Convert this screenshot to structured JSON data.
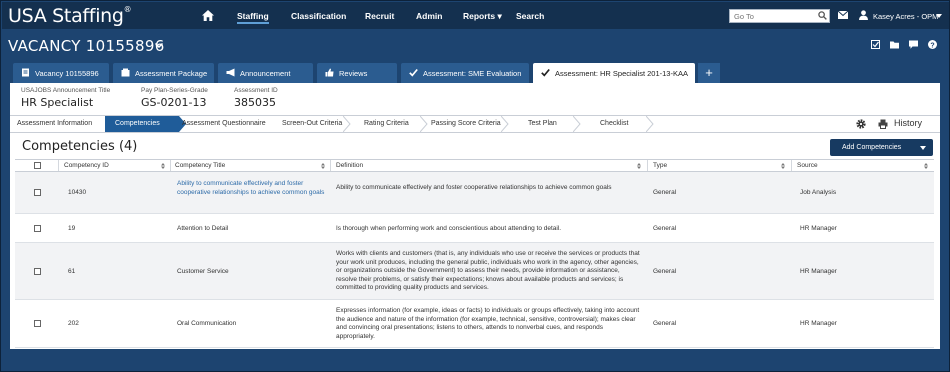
{
  "app": {
    "logo": "USA Staffing",
    "logo_mark": "®"
  },
  "topnav": {
    "items": [
      "Staffing",
      "Classification",
      "Recruit",
      "Admin",
      "Reports",
      "Search"
    ],
    "reports_caret": "▾",
    "goto_placeholder": "Go To",
    "user": "Kasey Acres - OPM"
  },
  "vacancy": {
    "title": "VACANCY 10155896"
  },
  "tabs": [
    {
      "label": "Vacancy 10155896",
      "icon": "document-icon"
    },
    {
      "label": "Assessment Package",
      "icon": "package-icon"
    },
    {
      "label": "Announcement",
      "icon": "megaphone-icon"
    },
    {
      "label": "Reviews",
      "icon": "thumbs-up-icon"
    },
    {
      "label": "Assessment: SME Evaluation",
      "icon": "check-icon"
    },
    {
      "label": "Assessment: HR Specialist 201-13-KAA",
      "icon": "check-icon"
    }
  ],
  "add_tab_label": "+",
  "meta": {
    "announcement_label": "USAJOBS Announcement Title",
    "announcement_value": "HR Specialist",
    "ppsg_label": "Pay Plan-Series-Grade",
    "ppsg_value": "GS-0201-13",
    "assessment_label": "Assessment ID",
    "assessment_value": "385035"
  },
  "steps": [
    "Assessment Information",
    "Competencies",
    "Assessment Questionnaire",
    "Screen-Out Criteria",
    "Rating Criteria",
    "Passing Score Criteria",
    "Test Plan",
    "Checklist"
  ],
  "active_step": "Competencies",
  "history_label": "History",
  "section": {
    "title": "Competencies (4)",
    "add_button": "Add Competencies"
  },
  "table": {
    "headers": [
      "Competency ID",
      "Competency Title",
      "Definition",
      "Type",
      "Source"
    ],
    "rows": [
      {
        "id": "10430",
        "title": "Ability to communicate effectively and foster cooperative relationships to achieve common goals",
        "definition": "Ability to communicate effectively and foster cooperative relationships to achieve common goals",
        "type": "General",
        "source": "Job Analysis"
      },
      {
        "id": "19",
        "title": "Attention to Detail",
        "definition": "Is thorough when performing work and conscientious about attending to detail.",
        "type": "General",
        "source": "HR Manager"
      },
      {
        "id": "61",
        "title": "Customer Service",
        "definition": "Works with clients and customers (that is, any individuals who use or receive the services or products that your work unit produces, including the general public, individuals who work in the agency, other agencies, or organizations outside the Government) to assess their needs, provide information or assistance, resolve their problems, or satisfy their expectations; knows about available products and services; is committed to providing quality products and services.",
        "type": "General",
        "source": "HR Manager"
      },
      {
        "id": "202",
        "title": "Oral Communication",
        "definition": "Expresses information (for example, ideas or facts) to individuals or groups effectively, taking into account the audience and nature of the information (for example, technical, sensitive, controversial); makes clear and convincing oral presentations; listens to others, attends to nonverbal cues, and responds appropriately.",
        "type": "General",
        "source": "HR Manager"
      }
    ]
  },
  "colors": {
    "nav_bg": "#14304f",
    "page_bg": "#1d4470",
    "tab_bg": "#2b5c90",
    "accent": "#1f5c99",
    "button_bg": "#173a61",
    "link": "#2d6ba8"
  }
}
